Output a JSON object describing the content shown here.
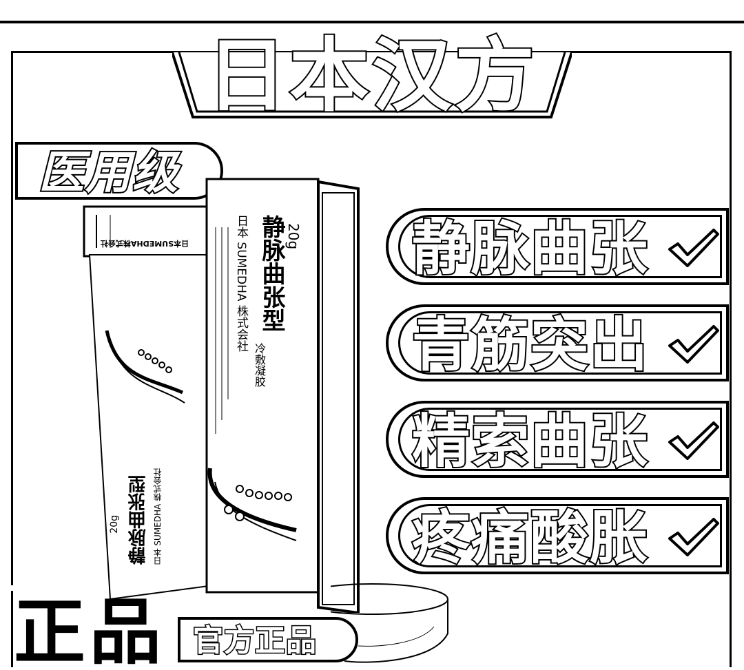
{
  "header": {
    "title": "日本汉方"
  },
  "badge": {
    "label": "医用级"
  },
  "product": {
    "box_brand": "日本 SUMEDHA 株式会社",
    "box_name": "静脉曲张型",
    "box_subname": "冷敷凝胶",
    "box_weight": "20g",
    "flap_text": "日本SUMEDHA株式会社",
    "tube_name": "静脉曲张型",
    "tube_brand": "日本 SUMEDHA 株式会社",
    "tube_weight": "20g"
  },
  "symptoms": [
    {
      "label": "静脉曲张",
      "icon": "checkmark-icon"
    },
    {
      "label": "青筋突出",
      "icon": "checkmark-icon"
    },
    {
      "label": "精索曲张",
      "icon": "checkmark-icon"
    },
    {
      "label": "疼痛酸胀",
      "icon": "checkmark-icon"
    }
  ],
  "footer": {
    "authentic": "正品",
    "official_badge": "官方正品"
  }
}
